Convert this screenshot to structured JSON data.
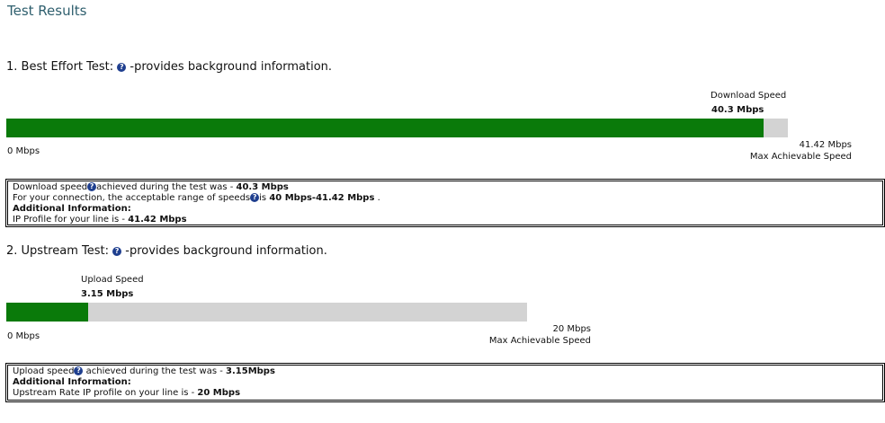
{
  "page_title": "Test Results",
  "best_effort": {
    "heading": "1. Best Effort Test:",
    "help_suffix": "-provides background information.",
    "bar_label": "Download Speed",
    "bar_value": "40.3 Mbps",
    "min_label": "0 Mbps",
    "max_value": "41.42 Mbps",
    "max_label": "Max Achievable Speed",
    "fill_fraction": 0.969,
    "colors": {
      "fill": "#0a7a0a",
      "track": "#d3d3d3"
    },
    "info": {
      "line1_pre": "Download speed",
      "line1_mid": "achieved during the test was - ",
      "line1_val": "40.3 Mbps",
      "line2_pre": "For your connection, the acceptable range of speeds",
      "line2_mid": "is ",
      "line2_val": "40 Mbps-41.42 Mbps",
      "line2_post": " .",
      "line3": "Additional Information:",
      "line4_pre": "IP Profile for your line is - ",
      "line4_val": "41.42 Mbps"
    }
  },
  "upstream": {
    "heading": "2. Upstream Test:",
    "help_suffix": "-provides background information.",
    "bar_label": "Upload Speed",
    "bar_value": "3.15 Mbps",
    "min_label": "0 Mbps",
    "max_value": "20 Mbps",
    "max_label": "Max Achievable Speed",
    "fill_fraction": 0.1575,
    "colors": {
      "fill": "#0a7a0a",
      "track": "#d3d3d3"
    },
    "info": {
      "line1_pre": "Upload speed",
      "line1_mid": " achieved during the test was - ",
      "line1_val": "3.15Mbps",
      "line2": "Additional Information:",
      "line3_pre": "Upstream Rate IP profile on your line is - ",
      "line3_val": "20 Mbps"
    }
  },
  "icons": {
    "help": "help-question-icon"
  },
  "help_glyph": "?"
}
